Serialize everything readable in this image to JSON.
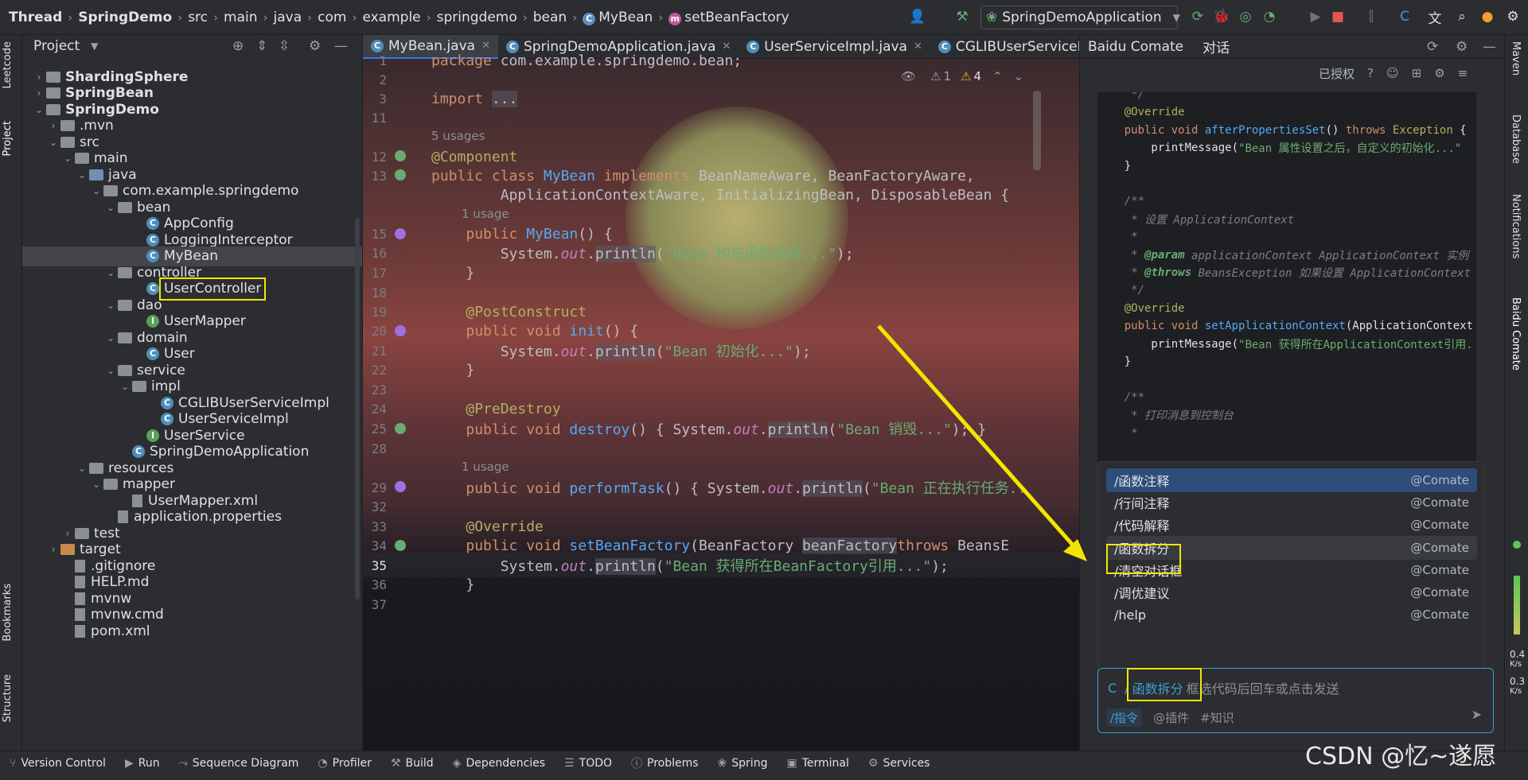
{
  "topbar": {
    "breadcrumbs": [
      "Thread",
      "SpringDemo",
      "src",
      "main",
      "java",
      "com",
      "example",
      "springdemo",
      "bean",
      "MyBean",
      "setBeanFactory"
    ],
    "run_config": "SpringDemoApplication"
  },
  "left_stripe": {
    "labels": [
      "Leetcode",
      "Project",
      "Bookmarks",
      "Structure"
    ]
  },
  "project": {
    "title": "Project",
    "tree": [
      {
        "label": "ShardingSphere",
        "depth": 1,
        "bold": true,
        "arrow": "›",
        "icon": "module"
      },
      {
        "label": "SpringBean",
        "depth": 1,
        "bold": true,
        "arrow": "›",
        "icon": "module"
      },
      {
        "label": "SpringDemo",
        "depth": 1,
        "bold": true,
        "arrow": "⌄",
        "icon": "module"
      },
      {
        "label": ".mvn",
        "depth": 2,
        "arrow": "›",
        "icon": "folder"
      },
      {
        "label": "src",
        "depth": 2,
        "arrow": "⌄",
        "icon": "folder"
      },
      {
        "label": "main",
        "depth": 3,
        "arrow": "⌄",
        "icon": "folder"
      },
      {
        "label": "java",
        "depth": 4,
        "arrow": "⌄",
        "icon": "folder-blue"
      },
      {
        "label": "com.example.springdemo",
        "depth": 5,
        "arrow": "⌄",
        "icon": "folder"
      },
      {
        "label": "bean",
        "depth": 6,
        "arrow": "⌄",
        "icon": "folder"
      },
      {
        "label": "AppConfig",
        "depth": 8,
        "icon": "class"
      },
      {
        "label": "LoggingInterceptor",
        "depth": 8,
        "icon": "class"
      },
      {
        "label": "MyBean",
        "depth": 8,
        "icon": "class",
        "selected": true
      },
      {
        "label": "controller",
        "depth": 6,
        "arrow": "⌄",
        "icon": "folder"
      },
      {
        "label": "UserController",
        "depth": 8,
        "icon": "class"
      },
      {
        "label": "dao",
        "depth": 6,
        "arrow": "⌄",
        "icon": "folder"
      },
      {
        "label": "UserMapper",
        "depth": 8,
        "icon": "interface"
      },
      {
        "label": "domain",
        "depth": 6,
        "arrow": "⌄",
        "icon": "folder"
      },
      {
        "label": "User",
        "depth": 8,
        "icon": "class"
      },
      {
        "label": "service",
        "depth": 6,
        "arrow": "⌄",
        "icon": "folder"
      },
      {
        "label": "impl",
        "depth": 7,
        "arrow": "⌄",
        "icon": "folder"
      },
      {
        "label": "CGLIBUserServiceImpl",
        "depth": 9,
        "icon": "class"
      },
      {
        "label": "UserServiceImpl",
        "depth": 9,
        "icon": "class"
      },
      {
        "label": "UserService",
        "depth": 8,
        "icon": "interface"
      },
      {
        "label": "SpringDemoApplication",
        "depth": 7,
        "icon": "class"
      },
      {
        "label": "resources",
        "depth": 4,
        "arrow": "⌄",
        "icon": "folder"
      },
      {
        "label": "mapper",
        "depth": 5,
        "arrow": "⌄",
        "icon": "folder"
      },
      {
        "label": "UserMapper.xml",
        "depth": 7,
        "icon": "file"
      },
      {
        "label": "application.properties",
        "depth": 6,
        "icon": "file"
      },
      {
        "label": "test",
        "depth": 3,
        "arrow": "›",
        "icon": "folder"
      },
      {
        "label": "target",
        "depth": 2,
        "arrow": "›",
        "icon": "folder-orange"
      },
      {
        "label": ".gitignore",
        "depth": 3,
        "icon": "file"
      },
      {
        "label": "HELP.md",
        "depth": 3,
        "icon": "file"
      },
      {
        "label": "mvnw",
        "depth": 3,
        "icon": "file"
      },
      {
        "label": "mvnw.cmd",
        "depth": 3,
        "icon": "file"
      },
      {
        "label": "pom.xml",
        "depth": 3,
        "icon": "file"
      }
    ]
  },
  "editor": {
    "tabs": [
      "MyBean.java",
      "SpringDemoApplication.java",
      "UserServiceImpl.java",
      "CGLIBUserServiceI"
    ],
    "inspections": {
      "warnings": "1",
      "weak": "4"
    },
    "usages": {
      "five": "5 usages",
      "one": "1 usage"
    },
    "lines": [
      {
        "n": "1",
        "t": [
          [
            "kw",
            "package "
          ],
          [
            "",
            "com.example.springdemo.bean;"
          ]
        ]
      },
      {
        "n": "2",
        "t": []
      },
      {
        "n": "3",
        "t": [
          [
            "kw",
            "import "
          ],
          [
            "hi",
            "..."
          ]
        ]
      },
      {
        "n": "11",
        "t": []
      },
      {
        "n": "12",
        "t": [
          [
            "an",
            "@Component"
          ]
        ]
      },
      {
        "n": "13",
        "t": [
          [
            "kw",
            "public class "
          ],
          [
            "fn",
            "MyBean "
          ],
          [
            "kw",
            "implements "
          ],
          [
            "",
            "BeanNameAware, BeanFactoryAware,"
          ]
        ]
      },
      {
        "n": "",
        "t": [
          [
            "",
            "        ApplicationContextAware, InitializingBean, DisposableBean {"
          ]
        ]
      },
      {
        "n": "15",
        "t": [
          [
            "",
            "    "
          ],
          [
            "kw",
            "public "
          ],
          [
            "fn",
            "MyBean"
          ],
          [
            "",
            "() {"
          ]
        ]
      },
      {
        "n": "16",
        "t": [
          [
            "",
            "        System."
          ],
          [
            "it",
            "out"
          ],
          [
            "",
            "."
          ],
          [
            "hi",
            "println"
          ],
          [
            "",
            "("
          ],
          [
            "st",
            "\"Bean 构造函数调用...\""
          ],
          [
            "",
            ");"
          ]
        ]
      },
      {
        "n": "17",
        "t": [
          [
            "",
            "    }"
          ]
        ]
      },
      {
        "n": "18",
        "t": []
      },
      {
        "n": "19",
        "t": [
          [
            "",
            "    "
          ],
          [
            "an",
            "@PostConstruct"
          ]
        ]
      },
      {
        "n": "20",
        "t": [
          [
            "",
            "    "
          ],
          [
            "kw",
            "public void "
          ],
          [
            "fn",
            "init"
          ],
          [
            "",
            "() {"
          ]
        ]
      },
      {
        "n": "21",
        "t": [
          [
            "",
            "        System."
          ],
          [
            "it",
            "out"
          ],
          [
            "",
            "."
          ],
          [
            "hi",
            "println"
          ],
          [
            "",
            "("
          ],
          [
            "st",
            "\"Bean 初始化...\""
          ],
          [
            "",
            ");"
          ]
        ]
      },
      {
        "n": "22",
        "t": [
          [
            "",
            "    }"
          ]
        ]
      },
      {
        "n": "23",
        "t": []
      },
      {
        "n": "24",
        "t": [
          [
            "",
            "    "
          ],
          [
            "an",
            "@PreDestroy"
          ]
        ]
      },
      {
        "n": "25",
        "t": [
          [
            "",
            "    "
          ],
          [
            "kw",
            "public void "
          ],
          [
            "fn",
            "destroy"
          ],
          [
            "",
            "() { System."
          ],
          [
            "it",
            "out"
          ],
          [
            "",
            "."
          ],
          [
            "hi",
            "println"
          ],
          [
            "",
            "("
          ],
          [
            "st",
            "\"Bean 销毁...\""
          ],
          [
            "",
            "); }"
          ]
        ]
      },
      {
        "n": "28",
        "t": []
      },
      {
        "n": "29",
        "t": [
          [
            "",
            "    "
          ],
          [
            "kw",
            "public void "
          ],
          [
            "fn",
            "performTask"
          ],
          [
            "",
            "() { System."
          ],
          [
            "it",
            "out"
          ],
          [
            "",
            "."
          ],
          [
            "hi",
            "println"
          ],
          [
            "",
            "("
          ],
          [
            "st",
            "\"Bean 正在执行任务.."
          ]
        ]
      },
      {
        "n": "32",
        "t": []
      },
      {
        "n": "33",
        "t": [
          [
            "",
            "    "
          ],
          [
            "an",
            "@Override"
          ]
        ]
      },
      {
        "n": "34",
        "t": [
          [
            "",
            "    "
          ],
          [
            "kw",
            "public void "
          ],
          [
            "fn",
            "setBeanFactory"
          ],
          [
            "",
            "(BeanFactory "
          ],
          [
            "hi",
            "beanFactory"
          ],
          [
            ") "
          ],
          [
            "kw",
            "throws "
          ],
          [
            "",
            "BeansE"
          ]
        ]
      },
      {
        "n": "35",
        "t": [
          [
            "",
            "        System."
          ],
          [
            "it",
            "out"
          ],
          [
            "",
            "."
          ],
          [
            "hi",
            "println"
          ],
          [
            "",
            "("
          ],
          [
            "st",
            "\"Bean 获得所在BeanFactory引用...\""
          ],
          [
            "",
            ");"
          ]
        ]
      },
      {
        "n": "36",
        "t": [
          [
            "",
            "    }"
          ]
        ]
      },
      {
        "n": "37",
        "t": []
      }
    ]
  },
  "comate": {
    "title": "Baidu Comate",
    "tab": "对话",
    "authorized": "已授权",
    "code": [
      [
        [
          "cmt",
          "     */"
        ]
      ],
      [
        [
          "an",
          "    @Override"
        ]
      ],
      [
        [
          "kw",
          "    public void "
        ],
        [
          "fn",
          "afterPropertiesSet"
        ],
        [
          "",
          "() "
        ],
        [
          "kw",
          "throws "
        ],
        [
          "an",
          "Exception"
        ],
        [
          "",
          " {"
        ]
      ],
      [
        [
          "",
          "        printMessage("
        ],
        [
          "st",
          "\"Bean 属性设置之后，自定义的初始化...\""
        ]
      ],
      [
        [
          "",
          "    }"
        ]
      ],
      [],
      [
        [
          "cmt",
          "    /**"
        ]
      ],
      [
        [
          "cmt",
          "     * 设置 ApplicationContext"
        ]
      ],
      [
        [
          "cmt",
          "     *"
        ]
      ],
      [
        [
          "cmt",
          "     * "
        ],
        [
          "jd",
          "@param"
        ],
        [
          "cmt",
          " applicationContext ApplicationContext 实例"
        ]
      ],
      [
        [
          "cmt",
          "     * "
        ],
        [
          "jd",
          "@throws"
        ],
        [
          "cmt",
          " BeansException 如果设置 ApplicationContext"
        ]
      ],
      [
        [
          "cmt",
          "     */"
        ]
      ],
      [
        [
          "an",
          "    @Override"
        ]
      ],
      [
        [
          "kw",
          "    public void "
        ],
        [
          "fn",
          "setApplicationContext"
        ],
        [
          "",
          "(ApplicationContext"
        ]
      ],
      [
        [
          "",
          "        printMessage("
        ],
        [
          "st",
          "\"Bean 获得所在ApplicationContext引用."
        ]
      ],
      [
        [
          "",
          "    }"
        ]
      ],
      [],
      [
        [
          "cmt",
          "    /**"
        ]
      ],
      [
        [
          "cmt",
          "     * 打印消息到控制台"
        ]
      ],
      [
        [
          "cmt",
          "     *"
        ]
      ]
    ],
    "menu": [
      {
        "cmd": "/函数注释",
        "tag": "@Comate"
      },
      {
        "cmd": "/行间注释",
        "tag": "@Comate"
      },
      {
        "cmd": "/代码解释",
        "tag": "@Comate"
      },
      {
        "cmd": "/函数拆分",
        "tag": "@Comate"
      },
      {
        "cmd": "/清空对话框",
        "tag": "@Comate"
      },
      {
        "cmd": "/调优建议",
        "tag": "@Comate"
      },
      {
        "cmd": "/help",
        "tag": "@Comate"
      }
    ],
    "input": {
      "prefix": "/",
      "command": "函数拆分",
      "hint": "框选代码后回车或点击发送"
    },
    "modes": [
      "/指令",
      "@插件",
      "#知识"
    ]
  },
  "right_stripe": {
    "labels": [
      "Maven",
      "Database",
      "Notifications",
      "Baidu Comate"
    ],
    "net_up": "0.4",
    "net_down": "0.3",
    "unit": "K/s"
  },
  "bottom": {
    "tools": [
      "Version Control",
      "Run",
      "Sequence Diagram",
      "Profiler",
      "Build",
      "Dependencies",
      "TODO",
      "Problems",
      "Spring",
      "Terminal",
      "Services"
    ]
  },
  "watermark": "CSDN @忆~遂愿",
  "colors": {
    "accent": "#3574f0",
    "highlight_box": "#f2e600",
    "arrow": "#f2e600"
  }
}
